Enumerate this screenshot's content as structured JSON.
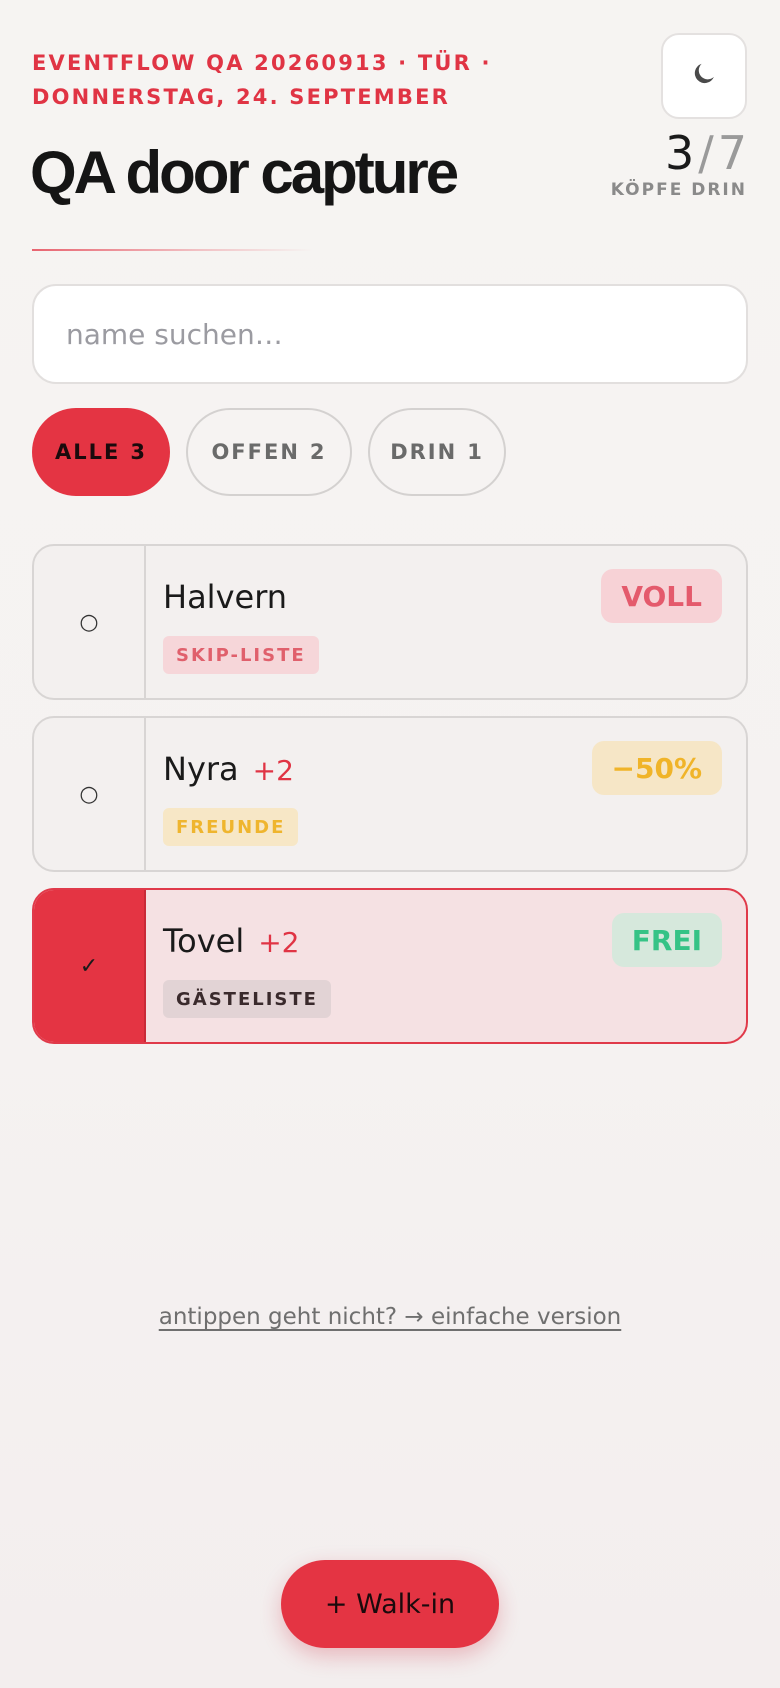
{
  "header": {
    "eyebrow": "EVENTFLOW QA 20260913 · TÜR · DONNERSTAG, 24. SEPTEMBER",
    "title": "QA door capture",
    "theme_toggle_icon": "moon-icon"
  },
  "counter": {
    "inside": "3",
    "separator": "/",
    "capacity": "7",
    "label": "KÖPFE DRIN"
  },
  "search": {
    "placeholder": "name suchen…",
    "value": ""
  },
  "filters": [
    {
      "label": "ALLE",
      "count": "3",
      "active": true
    },
    {
      "label": "OFFEN",
      "count": "2",
      "active": false
    },
    {
      "label": "DRIN",
      "count": "1",
      "active": false
    }
  ],
  "guests": [
    {
      "name": "Halvern",
      "plus": "",
      "tag": "SKIP-LISTE",
      "badge": "VOLL",
      "checked": false,
      "check_glyph": "○"
    },
    {
      "name": "Nyra",
      "plus": "+2",
      "tag": "FREUNDE",
      "badge": "−50%",
      "checked": false,
      "check_glyph": "○"
    },
    {
      "name": "Tovel",
      "plus": "+2",
      "tag": "GÄSTELISTE",
      "badge": "FREI",
      "checked": true,
      "check_glyph": "✓"
    }
  ],
  "colors": {
    "accent": "#e43443",
    "badge_full_bg": "#f7d2d6",
    "badge_full_fg": "#e45a6c",
    "badge_half_bg": "#f6e6c6",
    "badge_half_fg": "#f0b429",
    "badge_free_bg": "#d6e8dc",
    "badge_free_fg": "#35c386",
    "tag_skip_bg": "#f6d6d9",
    "tag_skip_fg": "#e0606c",
    "tag_friends_bg": "#f7e7c6",
    "tag_friends_fg": "#efb52e",
    "tag_guest_bg": "#e2d3d5",
    "tag_guest_fg": "#3a2a2c"
  },
  "footer": {
    "fallback_link": "antippen geht nicht? → einfache version",
    "walkin_button": "+ Walk-in"
  }
}
